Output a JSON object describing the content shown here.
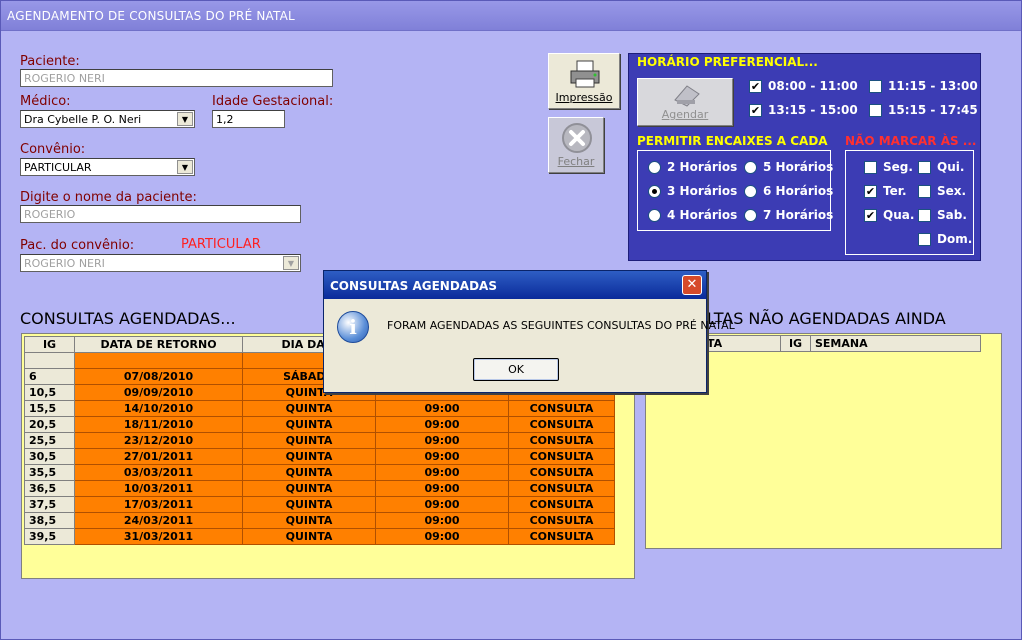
{
  "window": {
    "title": "AGENDAMENTO DE CONSULTAS DO PRÉ NATAL"
  },
  "form": {
    "paciente_label": "Paciente:",
    "paciente_value": "ROGERIO NERI",
    "medico_label": "Médico:",
    "medico_value": "Dra Cybelle P. O. Neri",
    "idade_label": "Idade Gestacional:",
    "idade_value": "1,2",
    "convenio_label": "Convênio:",
    "convenio_value": "PARTICULAR",
    "digite_label": "Digite o nome da paciente:",
    "digite_value": "ROGERIO",
    "pac_conv_label": "Pac. do convênio:",
    "pac_conv_tag": "PARTICULAR",
    "pac_conv_value": "ROGERIO NERI"
  },
  "buttons": {
    "impressao": "Impressão",
    "fechar": "Fechar",
    "agendar": "Agendar"
  },
  "horario": {
    "title": "HORÁRIO PREFERENCIAL...",
    "options": [
      {
        "label": "08:00 - 11:00",
        "checked": true
      },
      {
        "label": "11:15 - 13:00",
        "checked": false
      },
      {
        "label": "13:15 - 15:00",
        "checked": true
      },
      {
        "label": "15:15 - 17:45",
        "checked": false
      }
    ]
  },
  "encaixes": {
    "title": "PERMITIR ENCAIXES A CADA",
    "options": [
      {
        "label": "2 Horários",
        "selected": false
      },
      {
        "label": "5 Horários",
        "selected": false
      },
      {
        "label": "3 Horários",
        "selected": true
      },
      {
        "label": "6 Horários",
        "selected": false
      },
      {
        "label": "4 Horários",
        "selected": false
      },
      {
        "label": "7 Horários",
        "selected": false
      }
    ]
  },
  "nao_marcar": {
    "title": "NÃO MARCAR ÀS ...",
    "days": [
      {
        "label": "Seg.",
        "checked": false
      },
      {
        "label": "Qui.",
        "checked": false
      },
      {
        "label": "Ter.",
        "checked": true
      },
      {
        "label": "Sex.",
        "checked": false
      },
      {
        "label": "Qua.",
        "checked": true
      },
      {
        "label": "Sab.",
        "checked": false
      },
      {
        "label": "Dom.",
        "checked": false
      }
    ]
  },
  "agendadas": {
    "title": "CONSULTAS AGENDADAS...",
    "headers": [
      "IG",
      "DATA DE RETORNO",
      "DIA DA S",
      "",
      ""
    ],
    "rows": [
      [
        "",
        "",
        "",
        "",
        ""
      ],
      [
        "6",
        "07/08/2010",
        "SÁBADO",
        "",
        ""
      ],
      [
        "10,5",
        "09/09/2010",
        "QUINTA",
        "",
        ""
      ],
      [
        "15,5",
        "14/10/2010",
        "QUINTA",
        "09:00",
        "CONSULTA"
      ],
      [
        "20,5",
        "18/11/2010",
        "QUINTA",
        "09:00",
        "CONSULTA"
      ],
      [
        "25,5",
        "23/12/2010",
        "QUINTA",
        "09:00",
        "CONSULTA"
      ],
      [
        "30,5",
        "27/01/2011",
        "QUINTA",
        "09:00",
        "CONSULTA"
      ],
      [
        "35,5",
        "03/03/2011",
        "QUINTA",
        "09:00",
        "CONSULTA"
      ],
      [
        "36,5",
        "10/03/2011",
        "QUINTA",
        "09:00",
        "CONSULTA"
      ],
      [
        "37,5",
        "17/03/2011",
        "QUINTA",
        "09:00",
        "CONSULTA"
      ],
      [
        "38,5",
        "24/03/2011",
        "QUINTA",
        "09:00",
        "CONSULTA"
      ],
      [
        "39,5",
        "31/03/2011",
        "QUINTA",
        "09:00",
        "CONSULTA"
      ]
    ]
  },
  "nao_agendadas": {
    "title": "LTAS NÃO AGENDADAS AINDA",
    "headers": [
      "TA",
      "IG",
      "SEMANA"
    ]
  },
  "dialog": {
    "title": "CONSULTAS AGENDADAS",
    "message": "FORAM AGENDADAS AS SEGUINTES CONSULTAS DO PRÉ NATAL",
    "ok": "OK",
    "close": "✕",
    "icon": "i"
  },
  "colors": {
    "background": "#b4b4f4",
    "panel": "#3c3cb4",
    "grid_row": "#ff8000",
    "grid_bg": "#ffff99",
    "label": "#800000",
    "yellow_title": "#ffff00",
    "red_title": "#ff3030"
  }
}
